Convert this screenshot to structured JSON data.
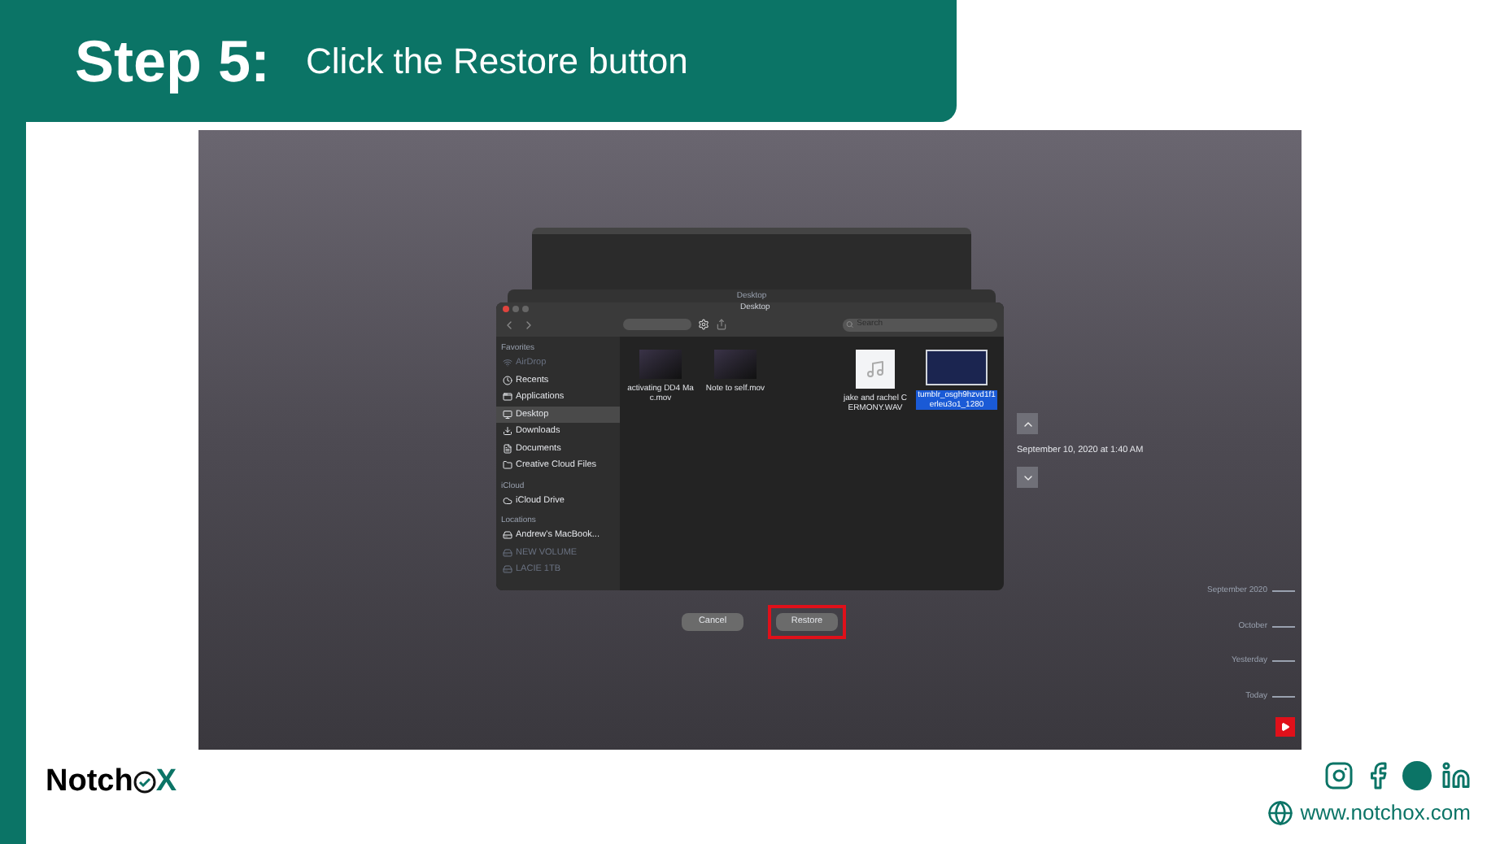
{
  "header": {
    "step": "Step 5:",
    "instruction": "Click the Restore button"
  },
  "finder": {
    "back_title": "Desktop",
    "title": "Desktop",
    "search": {
      "placeholder": "Search"
    },
    "sidebar": [
      {
        "heading": "Favorites",
        "items": [
          {
            "label": "AirDrop",
            "selected": false,
            "disabled": true
          },
          {
            "label": "Recents",
            "selected": false,
            "disabled": false
          },
          {
            "label": "Applications",
            "selected": false,
            "disabled": false
          },
          {
            "label": "Desktop",
            "selected": true,
            "disabled": false
          },
          {
            "label": "Downloads",
            "selected": false,
            "disabled": false
          },
          {
            "label": "Documents",
            "selected": false,
            "disabled": false
          },
          {
            "label": "Creative Cloud Files",
            "selected": false,
            "disabled": false
          }
        ]
      },
      {
        "heading": "iCloud",
        "items": [
          {
            "label": "iCloud Drive",
            "selected": false,
            "disabled": false
          }
        ]
      },
      {
        "heading": "Locations",
        "items": [
          {
            "label": "Andrew's MacBook...",
            "selected": false,
            "disabled": false
          },
          {
            "label": "NEW VOLUME",
            "selected": false,
            "disabled": true
          },
          {
            "label": "LACIE 1TB",
            "selected": false,
            "disabled": true
          }
        ]
      }
    ],
    "files": [
      {
        "name": "activating DD4 Mac.mov",
        "kind": "video",
        "selected": false
      },
      {
        "name": "Note to self.mov",
        "kind": "video",
        "selected": false
      },
      {
        "name": "jake and rachel CERMONY.WAV",
        "kind": "audio",
        "selected": false
      },
      {
        "name": "tumblr_osgh9hzvd1f1erleu3o1_1280",
        "kind": "image",
        "selected": true
      }
    ]
  },
  "buttons": [
    {
      "label": "Cancel",
      "highlighted": false
    },
    {
      "label": "Restore",
      "highlighted": true
    }
  ],
  "snapshot_date": "September 10, 2020 at 1:40 AM",
  "timeline": [
    "September 2020",
    "October",
    "Yesterday",
    "Today"
  ],
  "logo": {
    "prefix": "Notch",
    "suffix": "X"
  },
  "website": "www.notchox.com"
}
